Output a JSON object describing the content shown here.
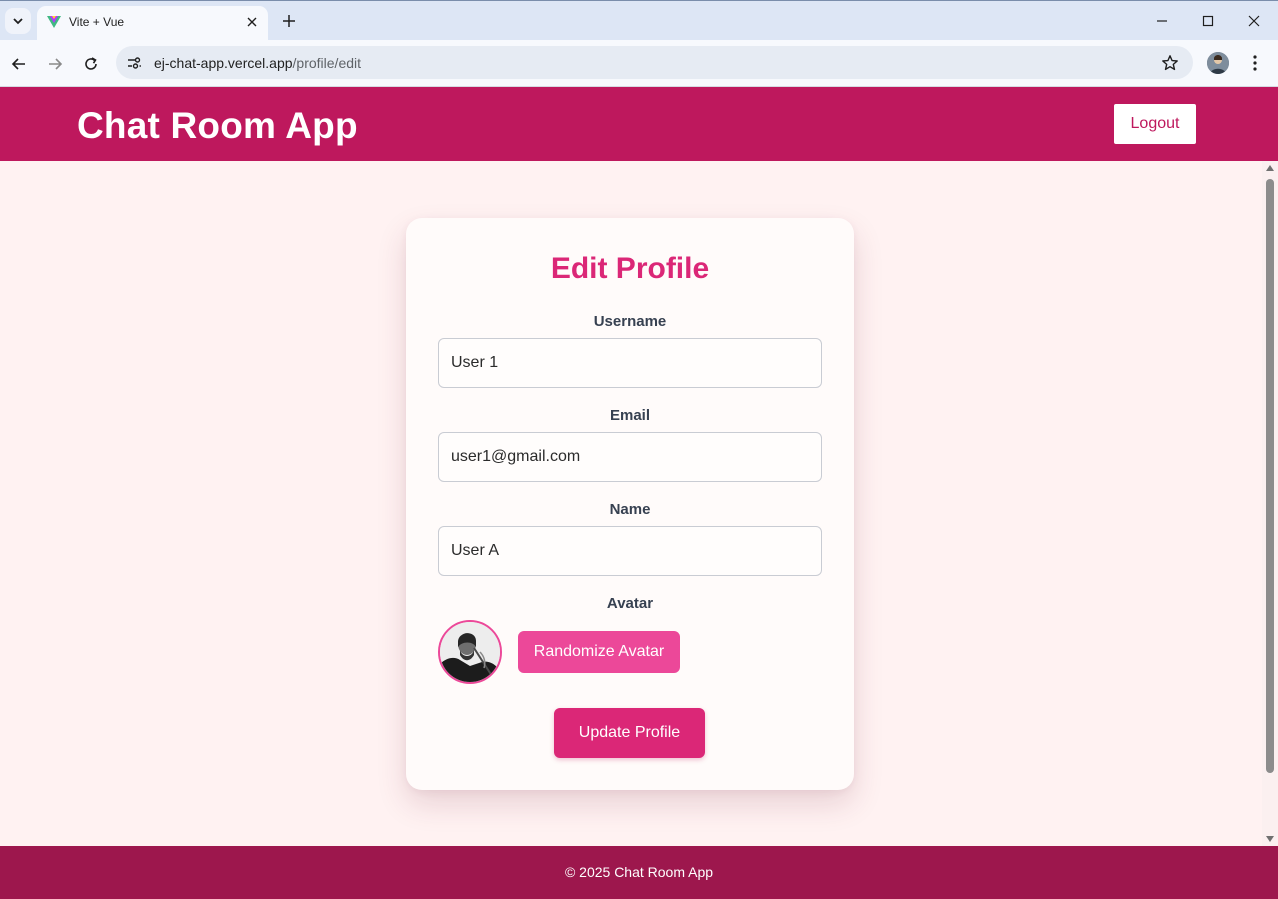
{
  "browser": {
    "tab_title": "Vite + Vue",
    "url_host": "ej-chat-app.vercel.app",
    "url_path": "/profile/edit"
  },
  "header": {
    "app_title": "Chat Room App",
    "logout_label": "Logout"
  },
  "form": {
    "title": "Edit Profile",
    "username_label": "Username",
    "username_value": "User 1",
    "email_label": "Email",
    "email_value": "user1@gmail.com",
    "name_label": "Name",
    "name_value": "User A",
    "avatar_label": "Avatar",
    "randomize_label": "Randomize Avatar",
    "update_label": "Update Profile"
  },
  "footer": {
    "text": "© 2025 Chat Room App"
  },
  "colors": {
    "header_bg": "#be185d",
    "footer_bg": "#9d174d",
    "accent": "#db2777",
    "button_pink": "#ec4899",
    "page_bg": "#fff2f2"
  },
  "icons": [
    "chevron-down-icon",
    "vue-icon",
    "close-icon",
    "plus-icon",
    "minimize-icon",
    "maximize-icon",
    "back-icon",
    "forward-icon",
    "reload-icon",
    "site-info-icon",
    "star-icon",
    "profile-icon",
    "more-vert-icon"
  ]
}
